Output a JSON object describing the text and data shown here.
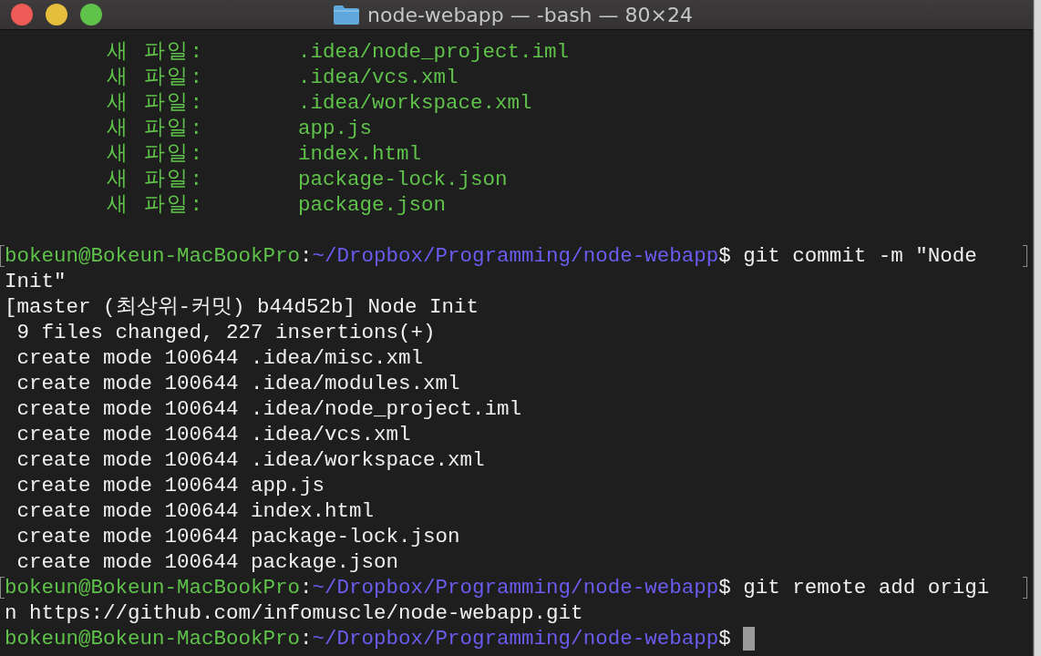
{
  "window": {
    "title": "node-webapp — -bash — 80×24"
  },
  "lines": [
    {
      "kind": "added",
      "label": "새 파일:",
      "path": ".idea/node_project.iml"
    },
    {
      "kind": "added",
      "label": "새 파일:",
      "path": ".idea/vcs.xml"
    },
    {
      "kind": "added",
      "label": "새 파일:",
      "path": ".idea/workspace.xml"
    },
    {
      "kind": "added",
      "label": "새 파일:",
      "path": "app.js"
    },
    {
      "kind": "added",
      "label": "새 파일:",
      "path": "index.html"
    },
    {
      "kind": "added",
      "label": "새 파일:",
      "path": "package-lock.json"
    },
    {
      "kind": "added",
      "label": "새 파일:",
      "path": "package.json"
    },
    {
      "kind": "blank"
    },
    {
      "kind": "prompt",
      "user": "bokeun@Bokeun-MacBookPro",
      "colon": ":",
      "path": "~/Dropbox/Programming/node-webapp",
      "sign": "$",
      "command": "git commit -m \"Node",
      "marked": true,
      "wrapped": true
    },
    {
      "kind": "output",
      "text": "Init\""
    },
    {
      "kind": "output",
      "text": "[master (최상위-커밋) b44d52b] Node Init"
    },
    {
      "kind": "output",
      "text": " 9 files changed, 227 insertions(+)"
    },
    {
      "kind": "output",
      "text": " create mode 100644 .idea/misc.xml"
    },
    {
      "kind": "output",
      "text": " create mode 100644 .idea/modules.xml"
    },
    {
      "kind": "output",
      "text": " create mode 100644 .idea/node_project.iml"
    },
    {
      "kind": "output",
      "text": " create mode 100644 .idea/vcs.xml"
    },
    {
      "kind": "output",
      "text": " create mode 100644 .idea/workspace.xml"
    },
    {
      "kind": "output",
      "text": " create mode 100644 app.js"
    },
    {
      "kind": "output",
      "text": " create mode 100644 index.html"
    },
    {
      "kind": "output",
      "text": " create mode 100644 package-lock.json"
    },
    {
      "kind": "output",
      "text": " create mode 100644 package.json"
    },
    {
      "kind": "prompt",
      "user": "bokeun@Bokeun-MacBookPro",
      "colon": ":",
      "path": "~/Dropbox/Programming/node-webapp",
      "sign": "$",
      "command": "git remote add origi",
      "marked": true,
      "wrapped": true
    },
    {
      "kind": "output",
      "text": "n https://github.com/infomuscle/node-webapp.git"
    },
    {
      "kind": "prompt",
      "user": "bokeun@Bokeun-MacBookPro",
      "colon": ":",
      "path": "~/Dropbox/Programming/node-webapp",
      "sign": "$",
      "marked": false,
      "wrapped": false,
      "cursor": true
    }
  ]
}
